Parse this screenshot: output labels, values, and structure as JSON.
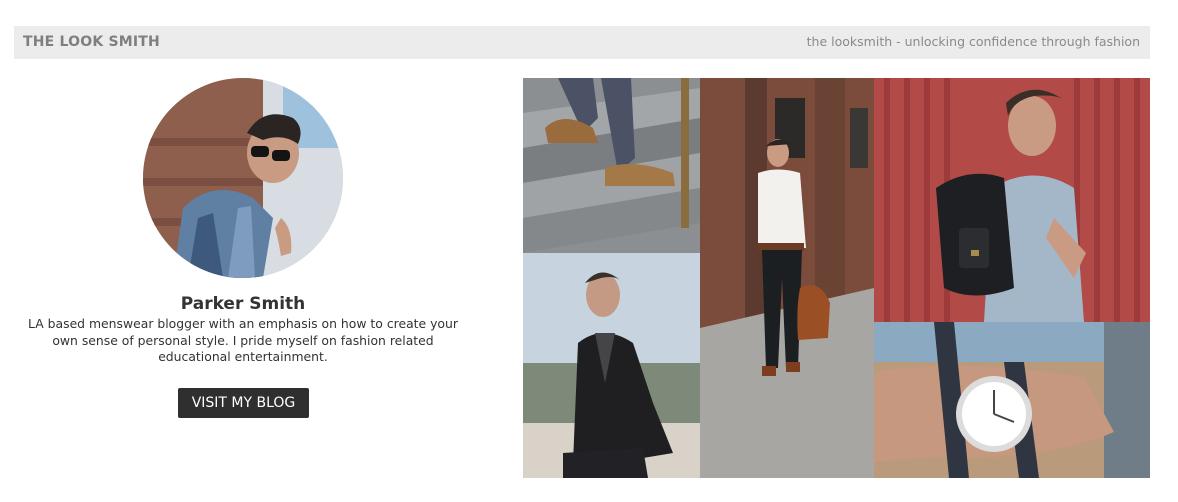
{
  "header": {
    "brand": "THE LOOK SMITH",
    "tagline": "the looksmith - unlocking confidence through fashion"
  },
  "profile": {
    "name": "Parker Smith",
    "bio": "LA based menswear blogger with an emphasis on how to create your own sense of personal style. I pride myself on fashion related educational entertainment.",
    "button_label": "VISIT MY BLOG"
  },
  "gallery": {
    "photos": [
      "man-walking-up-stairs-boots",
      "man-in-black-blazer-sitting",
      "man-walking-street-with-leather-bag",
      "man-with-black-backpack",
      "wrist-watch-closeup"
    ]
  }
}
